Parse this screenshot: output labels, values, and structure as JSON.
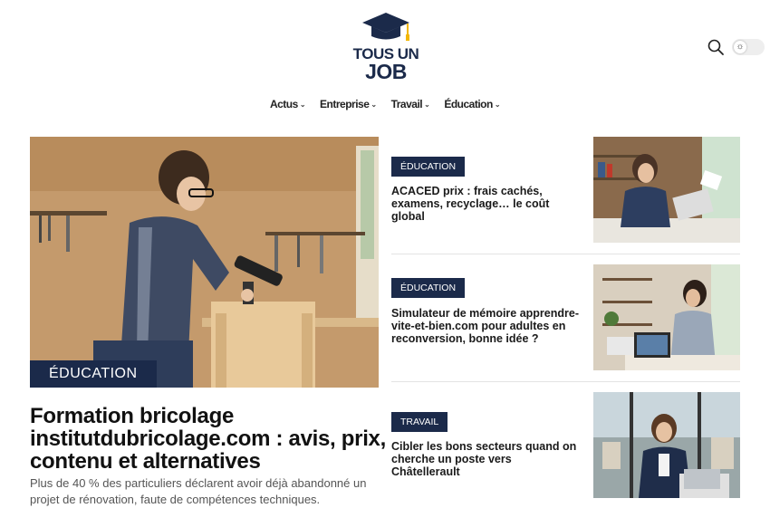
{
  "logo": {
    "line1": "TOUS UN",
    "line2": "JOB"
  },
  "header": {
    "search_icon": "search-icon",
    "theme_icon": "sun-icon"
  },
  "nav": [
    {
      "label": "Actus"
    },
    {
      "label": "Entreprise"
    },
    {
      "label": "Travail"
    },
    {
      "label": "Éducation"
    }
  ],
  "hero": {
    "category": "ÉDUCATION",
    "title": "Formation bricolage institutdubricolage.com : avis, prix, contenu et alternatives",
    "excerpt": "Plus de 40 % des particuliers déclarent avoir déjà abandonné un projet de rénovation, faute de compétences techniques."
  },
  "articles": [
    {
      "category": "ÉDUCATION",
      "title": "ACACED prix : frais cachés, examens, recyclage… le coût global"
    },
    {
      "category": "ÉDUCATION",
      "title": "Simulateur de mémoire apprendre-vite-et-bien.com pour adultes en reconversion, bonne idée ?"
    },
    {
      "category": "TRAVAIL",
      "title": "Cibler les bons secteurs quand on cherche un poste vers Châtellerault"
    }
  ],
  "colors": {
    "brand": "#1b2a4a",
    "accent": "#f2b705"
  }
}
